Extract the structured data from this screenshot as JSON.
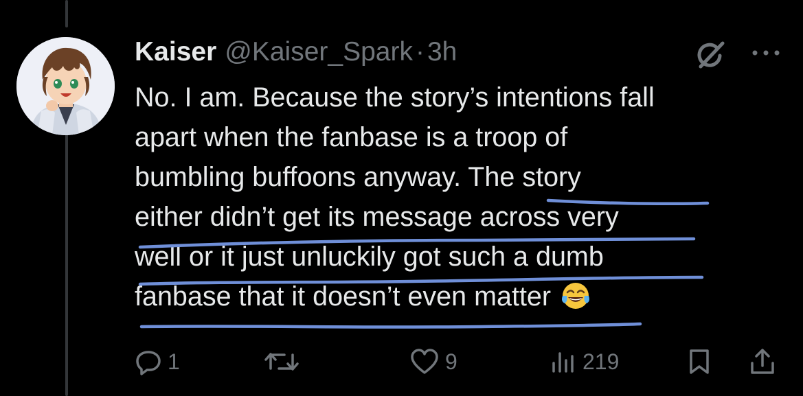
{
  "tweet": {
    "author": {
      "display_name": "Kaiser",
      "handle": "@Kaiser_Spark",
      "avatar_icon": "anime-avatar"
    },
    "separator": "·",
    "timestamp": "3h",
    "text_lines": [
      "No. I am. Because the story’s intentions fall",
      "apart when the fanbase is a troop of",
      "bumbling buffoons anyway. The story",
      "either didn’t get its message across very",
      "well or it just unluckily got such a dumb",
      "fanbase that it doesn’t even matter"
    ],
    "emoji": "😂",
    "annotation_color": "#6f8fd8"
  },
  "header_icons": {
    "grok": "grok-icon",
    "more": "more-icon"
  },
  "actions": {
    "reply": {
      "icon": "reply-icon",
      "count": "1"
    },
    "repost": {
      "icon": "repost-icon",
      "count": ""
    },
    "like": {
      "icon": "like-icon",
      "count": "9"
    },
    "views": {
      "icon": "views-icon",
      "count": "219"
    },
    "bookmark": {
      "icon": "bookmark-icon"
    },
    "share": {
      "icon": "share-icon"
    }
  },
  "colors": {
    "background": "#000000",
    "text_primary": "#e7e9ea",
    "text_secondary": "#71767b",
    "thread_line": "#333639"
  }
}
